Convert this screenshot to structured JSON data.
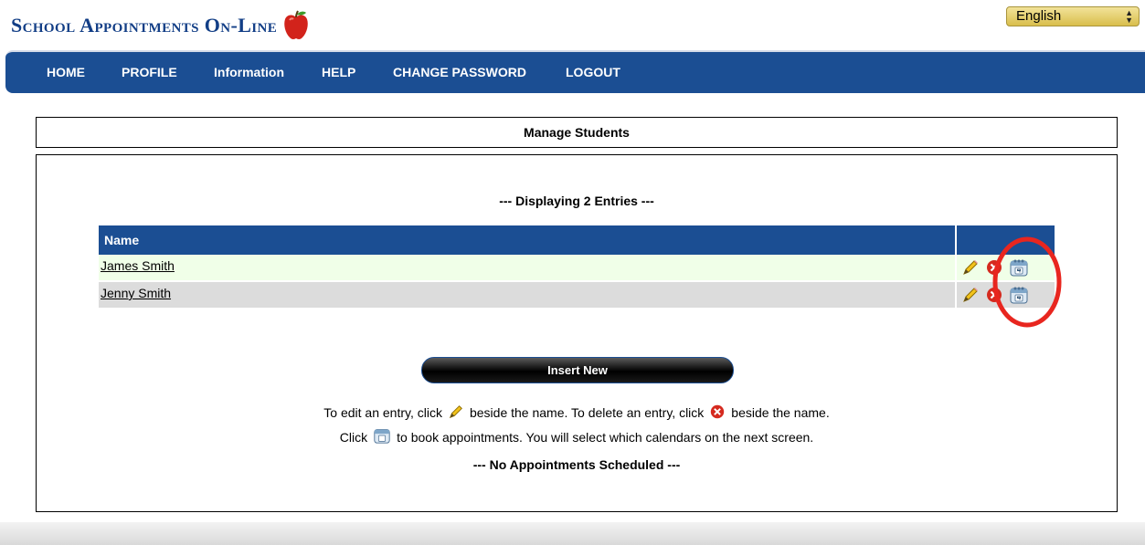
{
  "header": {
    "title": "School Appointments On-Line",
    "logo_icon": "apple-icon",
    "language": {
      "selected": "English"
    }
  },
  "nav": {
    "items": [
      {
        "label": "HOME"
      },
      {
        "label": "PROFILE"
      },
      {
        "label": "Information"
      },
      {
        "label": "HELP"
      },
      {
        "label": "CHANGE PASSWORD"
      },
      {
        "label": "LOGOUT"
      }
    ]
  },
  "panel": {
    "title": "Manage Students",
    "displaying": "--- Displaying 2 Entries ---",
    "table": {
      "header_name": "Name",
      "rows": [
        {
          "name": "James Smith"
        },
        {
          "name": "Jenny Smith"
        }
      ]
    },
    "insert_button": "Insert New",
    "help": {
      "part1": "To edit an entry, click",
      "part2": "beside the name. To delete an entry, click",
      "part3": "beside the name.",
      "part4": "Click",
      "part5": "to book appointments. You will select which calendars on the next screen."
    },
    "no_appointments": "--- No Appointments Scheduled ---"
  },
  "colors": {
    "brand_blue": "#1b4e93",
    "title_blue": "#123e86",
    "row_odd": "#f0ffe8",
    "row_even": "#dcdcdc",
    "highlight_red": "#e8261f"
  }
}
